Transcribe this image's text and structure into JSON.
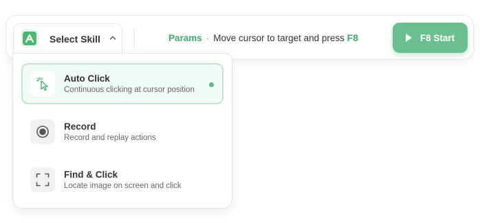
{
  "toolbar": {
    "logo_letter": "A",
    "select_skill_label": "Select Skill",
    "status": {
      "params_label": "Params",
      "separator": "·",
      "instruction": "Move cursor to target and press",
      "hotkey": "F8"
    },
    "start_button_label": "F8 Start"
  },
  "dropdown": {
    "items": [
      {
        "icon": "cursor-click-icon",
        "title": "Auto Click",
        "description": "Continuous clicking at cursor position",
        "selected": true
      },
      {
        "icon": "record-icon",
        "title": "Record",
        "description": "Record and replay actions",
        "selected": false
      },
      {
        "icon": "scan-frame-icon",
        "title": "Find & Click",
        "description": "Locate image on screen and click",
        "selected": false
      }
    ]
  },
  "colors": {
    "accent": "#4eb574",
    "accent_text": "#3fa96a",
    "start_button": "#6bbf8e",
    "selected_bg": "#f1faf4",
    "selected_border": "#bfe6cc"
  }
}
